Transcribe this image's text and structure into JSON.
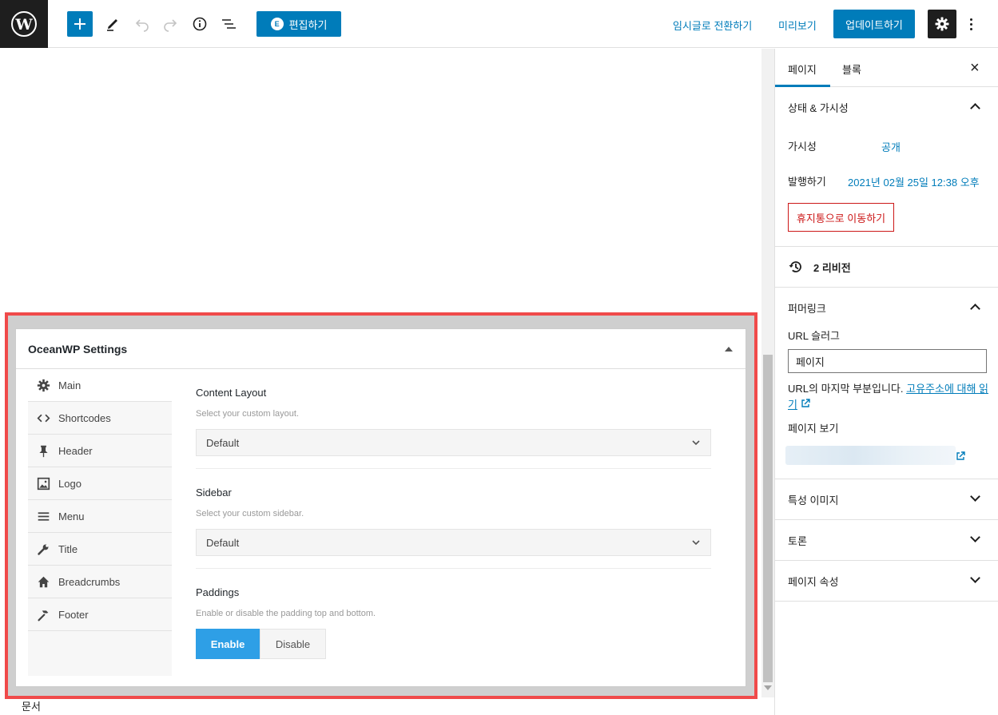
{
  "toolbar": {
    "elementor_label": "편집하기",
    "elementor_badge": "E",
    "switch_draft": "임시글로 전환하기",
    "preview": "미리보기",
    "update": "업데이트하기"
  },
  "metabox": {
    "title": "OceanWP Settings",
    "tabs": [
      {
        "label": "Main",
        "icon": "gear-icon"
      },
      {
        "label": "Shortcodes",
        "icon": "code-icon"
      },
      {
        "label": "Header",
        "icon": "pin-icon"
      },
      {
        "label": "Logo",
        "icon": "image-icon"
      },
      {
        "label": "Menu",
        "icon": "menu-icon"
      },
      {
        "label": "Title",
        "icon": "wrench-icon"
      },
      {
        "label": "Breadcrumbs",
        "icon": "home-icon"
      },
      {
        "label": "Footer",
        "icon": "hammer-icon"
      }
    ],
    "content_layout": {
      "label": "Content Layout",
      "desc": "Select your custom layout.",
      "value": "Default"
    },
    "sidebar": {
      "label": "Sidebar",
      "desc": "Select your custom sidebar.",
      "value": "Default"
    },
    "paddings": {
      "label": "Paddings",
      "desc": "Enable or disable the padding top and bottom.",
      "enable": "Enable",
      "disable": "Disable",
      "selected": "Enable"
    }
  },
  "footer": {
    "breadcrumb": "문서"
  },
  "sidebar": {
    "tabs": [
      "페이지",
      "블록"
    ],
    "status": {
      "title": "상태 & 가시성",
      "visibility_label": "가시성",
      "visibility_value": "공개",
      "publish_label": "발행하기",
      "publish_value": "2021년 02월 25일 12:38 오후",
      "trash": "휴지통으로 이동하기"
    },
    "revisions": "2 리비전",
    "permalink": {
      "title": "퍼머링크",
      "slug_label": "URL 슬러그",
      "slug_value": "페이지",
      "help_text": "URL의 마지막 부분입니다.",
      "help_link": "고유주소에 대해 읽기",
      "view_label": "페이지 보기"
    },
    "featured_image": "특성 이미지",
    "discussion": "토론",
    "page_attributes": "페이지 속성"
  },
  "colors": {
    "accent": "#007cba",
    "highlight": "#f04a4a",
    "toggle_on": "#2e9fe6",
    "danger": "#cc1818"
  }
}
